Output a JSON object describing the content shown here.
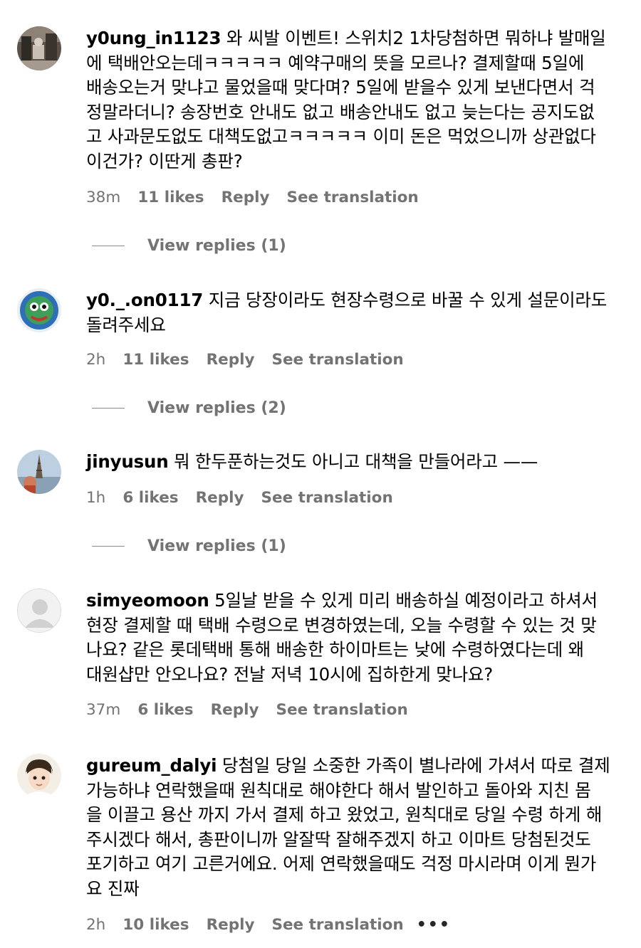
{
  "comments": [
    {
      "username": "y0ung_in1123",
      "text": "와 씨발 이벤트! 스위치2 1차당첨하면 뭐하냐 발매일\n에 택배안오는데ㅋㅋㅋㅋㅋ 예약구매의 뜻을 모르나? 결제할때 5일에\n배송오는거 맞냐고 물었을때 맞다며? 5일에 받을수 있게 보낸다면서 걱\n정말라더니? 송장번호 안내도 없고 배송안내도 없고 늦는다는 공지도없\n고 사과문도없도 대책도없고ㅋㅋㅋㅋㅋ 이미 돈은 먹었으니까 상관없다\n이건가? 이딴게 총판?",
      "time": "38m",
      "likes": "11 likes",
      "reply": "Reply",
      "translate": "See translation",
      "view_replies": "View replies (1)",
      "avatar_icon": "photo-avatar-dark-street"
    },
    {
      "username": "y0._.on0117",
      "text": "지금 당장이라도 현장수령으로 바꿀 수 있게 설문이라도\n돌려주세요",
      "time": "2h",
      "likes": "11 likes",
      "reply": "Reply",
      "translate": "See translation",
      "view_replies": "View replies (2)",
      "avatar_icon": "photo-avatar-blue-character"
    },
    {
      "username": "jinyusun",
      "text": "뭐 한두푼하는것도 아니고 대책을 만들어라고 ——",
      "time": "1h",
      "likes": "6 likes",
      "reply": "Reply",
      "translate": "See translation",
      "view_replies": "View replies (1)",
      "avatar_icon": "photo-avatar-eiffel-tower"
    },
    {
      "username": "simyeomoon",
      "text": "5일날 받을 수 있게 미리 배송하실 예정이라고 하셔서\n현장 결제할 때 택배 수령으로 변경하였는데, 오늘 수령할 수 있는 것 맞\n나요? 같은 롯데택배 통해 배송한 하이마트는 낮에 수령하였다는데 왜\n대원샵만 안오나요? 전날 저녁 10시에 집하한게 맞나요?",
      "time": "37m",
      "likes": "6 likes",
      "reply": "Reply",
      "translate": "See translation",
      "avatar_icon": "default-person-avatar"
    },
    {
      "username": "gureum_dalyi",
      "text": "당첨일 당일 소중한 가족이 별나라에 가셔서 따로 결제\n가능하냐 연락했을때 원칙대로 해야한다 해서 발인하고 돌아와 지친 몸\n을 이끌고 용산 까지 가서 결제 하고 왔었고, 원칙대로 당일 수령 하게 해\n주시겠다 해서, 총판이니까 알잘딱 잘해주겠지 하고 이마트 당첨된것도\n포기하고 여기 고른거에요. 어제 연락했을때도 걱정 마시라며 이게 뭔가\n요 진짜",
      "time": "2h",
      "likes": "10 likes",
      "reply": "Reply",
      "translate": "See translation",
      "more": "•••",
      "avatar_icon": "photo-avatar-cartoon-boy"
    }
  ]
}
